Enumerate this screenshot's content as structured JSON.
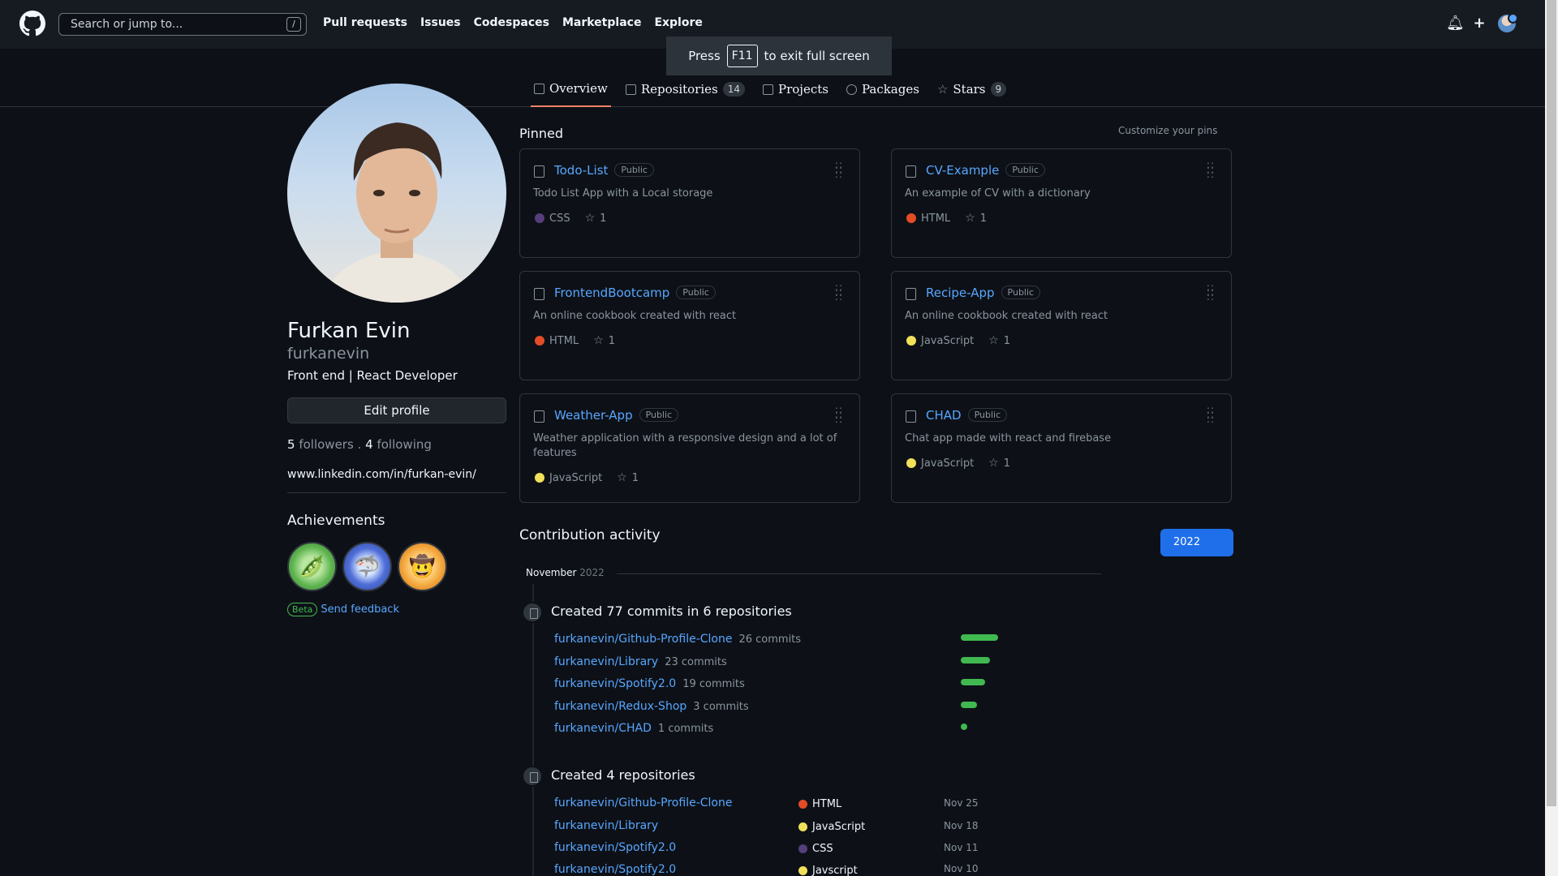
{
  "header": {
    "search_placeholder": "Search or jump to...",
    "search_shortcut": "/",
    "nav": [
      "Pull requests",
      "Issues",
      "Codespaces",
      "Marketplace",
      "Explore"
    ]
  },
  "toast": {
    "press": "Press",
    "key": "F11",
    "rest": "to exit full screen"
  },
  "tabs": [
    {
      "label": "Overview",
      "count": ""
    },
    {
      "label": "Repositories",
      "count": "14"
    },
    {
      "label": "Projects",
      "count": ""
    },
    {
      "label": "Packages",
      "count": ""
    },
    {
      "label": "Stars",
      "count": "9"
    }
  ],
  "profile": {
    "full_name": "Furkan Evin",
    "username": "furkanevin",
    "bio": "Front end | React Developer",
    "edit_label": "Edit profile",
    "followers_count": "5",
    "followers_label": "followers",
    "separator": ".",
    "following_count": "4",
    "following_label": "following",
    "website": "www.linkedin.com/in/furkan-evin/"
  },
  "achievements": {
    "title": "Achievements",
    "beta_label": "Beta",
    "feedback_label": "Send feedback"
  },
  "pinned": {
    "title": "Pinned",
    "customize_label": "Customize your pins",
    "repos": [
      {
        "name": "Todo-List",
        "visibility": "Public",
        "description": "Todo List App with a Local storage",
        "language": "CSS",
        "lang_color": "#563d7c",
        "stars": "1"
      },
      {
        "name": "CV-Example",
        "visibility": "Public",
        "description": "An example of CV with a dictionary",
        "language": "HTML",
        "lang_color": "#e34c26",
        "stars": "1"
      },
      {
        "name": "FrontendBootcamp",
        "visibility": "Public",
        "description": "An online cookbook created with react",
        "language": "HTML",
        "lang_color": "#e34c26",
        "stars": "1"
      },
      {
        "name": "Recipe-App",
        "visibility": "Public",
        "description": "An online cookbook created with react",
        "language": "JavaScript",
        "lang_color": "#f1e05a",
        "stars": "1"
      },
      {
        "name": "Weather-App",
        "visibility": "Public",
        "description": "Weather application with a responsive design and a lot of features",
        "language": "JavaScript",
        "lang_color": "#f1e05a",
        "stars": "1"
      },
      {
        "name": "CHAD",
        "visibility": "Public",
        "description": "Chat app made with react and firebase",
        "language": "JavaScript",
        "lang_color": "#f1e05a",
        "stars": "1"
      }
    ]
  },
  "contributions": {
    "title": "Contribution activity",
    "year": "2022",
    "month": "November",
    "month_year": "2022",
    "commits_title": "Created 77 commits in 6 repositories",
    "commits": [
      {
        "repo": "furkanevin/Github-Profile-Clone",
        "count": "26 commits",
        "share": 1.0
      },
      {
        "repo": "furkanevin/Library",
        "count": "23 commits",
        "share": 0.78
      },
      {
        "repo": "furkanevin/Spotify2.0",
        "count": "19 commits",
        "share": 0.66
      },
      {
        "repo": "furkanevin/Redux-Shop",
        "count": "3 commits",
        "share": 0.44
      },
      {
        "repo": "furkanevin/CHAD",
        "count": "1 commits",
        "share": 0.16
      }
    ],
    "repos_title": "Created 4 repositories",
    "created": [
      {
        "repo": "furkanevin/Github-Profile-Clone",
        "language": "HTML",
        "lang_color": "#e34c26",
        "date": "Nov 25"
      },
      {
        "repo": "furkanevin/Library",
        "language": "JavaScript",
        "lang_color": "#f1e05a",
        "date": "Nov 18"
      },
      {
        "repo": "furkanevin/Spotify2.0",
        "language": "CSS",
        "lang_color": "#563d7c",
        "date": "Nov 11"
      },
      {
        "repo": "furkanevin/Spotify2.0",
        "language": "Javscript",
        "lang_color": "#f1e05a",
        "date": "Nov 10"
      }
    ]
  }
}
